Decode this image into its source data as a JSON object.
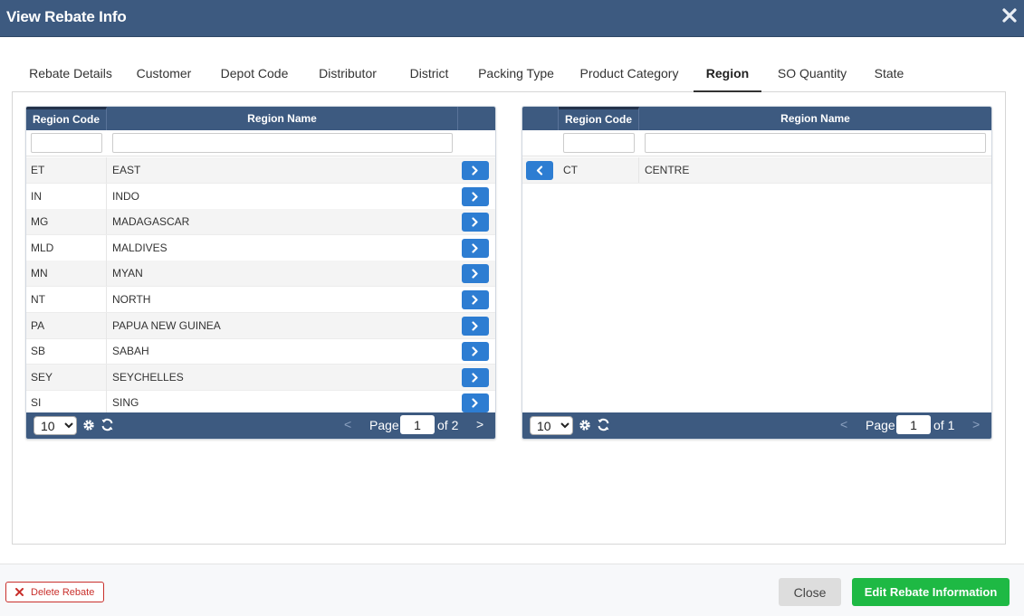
{
  "dialog": {
    "title": "View Rebate Info"
  },
  "tabs": [
    {
      "label": "Rebate Details"
    },
    {
      "label": "Customer"
    },
    {
      "label": "Depot Code"
    },
    {
      "label": "Distributor"
    },
    {
      "label": "District"
    },
    {
      "label": "Packing Type"
    },
    {
      "label": "Product Category"
    },
    {
      "label": "Region",
      "active": true
    },
    {
      "label": "SO Quantity"
    },
    {
      "label": "State"
    }
  ],
  "available_grid": {
    "columns": {
      "code": "Region Code",
      "name": "Region Name"
    },
    "rows": [
      {
        "code": "ET",
        "name": "EAST"
      },
      {
        "code": "IN",
        "name": "INDO"
      },
      {
        "code": "MG",
        "name": "MADAGASCAR"
      },
      {
        "code": "MLD",
        "name": "MALDIVES"
      },
      {
        "code": "MN",
        "name": "MYAN"
      },
      {
        "code": "NT",
        "name": "NORTH"
      },
      {
        "code": "PA",
        "name": "PAPUA NEW GUINEA"
      },
      {
        "code": "SB",
        "name": "SABAH"
      },
      {
        "code": "SEY",
        "name": "SEYCHELLES"
      },
      {
        "code": "SI",
        "name": "SING"
      }
    ],
    "pager": {
      "page_size": "10",
      "page_label": "Page",
      "page": "1",
      "of_label": "of 2",
      "prev": "<",
      "next": ">"
    }
  },
  "selected_grid": {
    "columns": {
      "code": "Region Code",
      "name": "Region Name"
    },
    "rows": [
      {
        "code": "CT",
        "name": "CENTRE"
      }
    ],
    "pager": {
      "page_size": "10",
      "page_label": "Page",
      "page": "1",
      "of_label": "of 1",
      "prev": "<",
      "next": ">"
    }
  },
  "footer": {
    "delete_label": "Delete Rebate",
    "close_label": "Close",
    "edit_label": "Edit Rebate Information"
  },
  "colors": {
    "header": "#3d5a80",
    "move_button": "#2d7dd2",
    "edit_button": "#1eb944",
    "delete_button": "#c9302c"
  }
}
